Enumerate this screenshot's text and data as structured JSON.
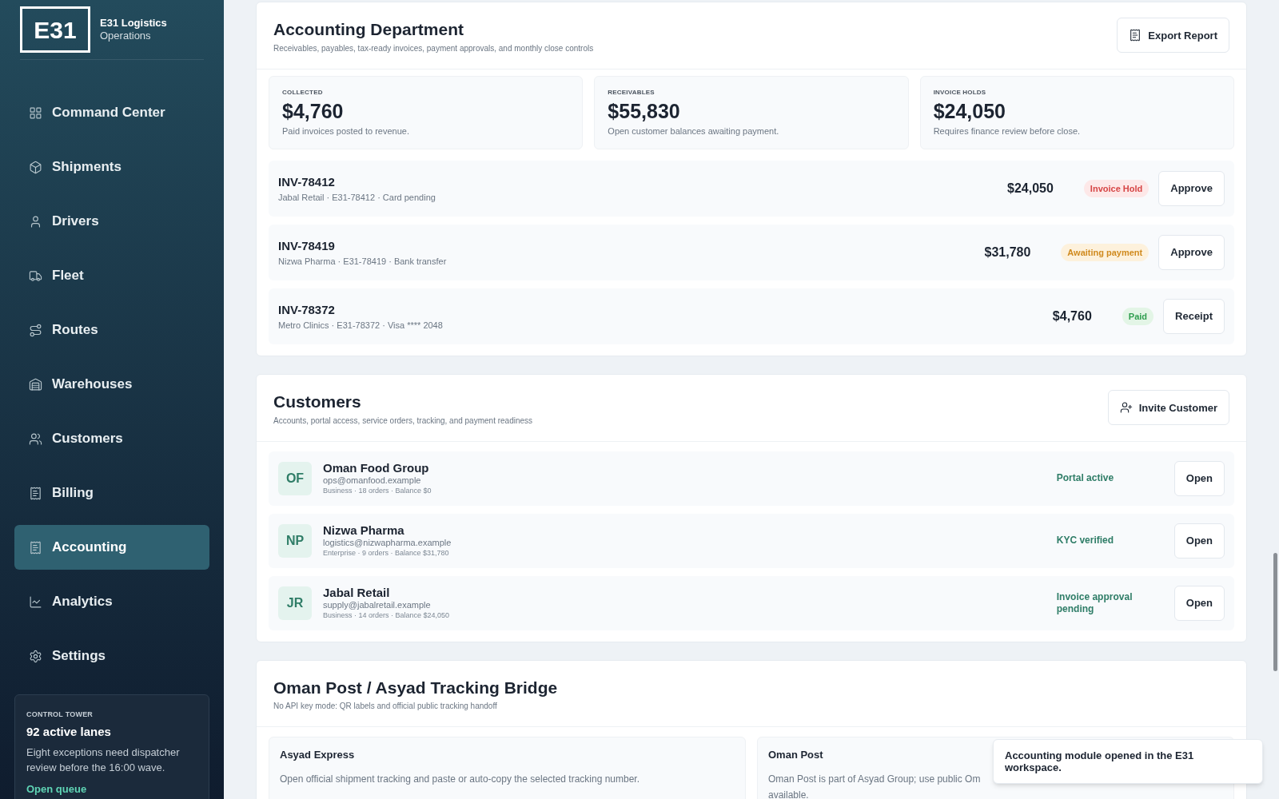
{
  "brand": {
    "logo": "E31",
    "name": "E31 Logistics",
    "subtitle": "Operations"
  },
  "nav": [
    {
      "label": "Command Center",
      "selected": false
    },
    {
      "label": "Shipments",
      "selected": false
    },
    {
      "label": "Drivers",
      "selected": false
    },
    {
      "label": "Fleet",
      "selected": false
    },
    {
      "label": "Routes",
      "selected": false
    },
    {
      "label": "Warehouses",
      "selected": false
    },
    {
      "label": "Customers",
      "selected": false
    },
    {
      "label": "Billing",
      "selected": false
    },
    {
      "label": "Accounting",
      "selected": true
    },
    {
      "label": "Analytics",
      "selected": false
    },
    {
      "label": "Settings",
      "selected": false
    }
  ],
  "control_tower": {
    "eyebrow": "CONTROL TOWER",
    "title": "92 active lanes",
    "text": "Eight exceptions need dispatcher review before the 16:00 wave.",
    "link": "Open queue"
  },
  "accounting": {
    "title": "Accounting Department",
    "subtitle": "Receivables, payables, tax-ready invoices, payment approvals, and monthly close controls",
    "action": "Export Report",
    "stats": [
      {
        "label": "COLLECTED",
        "value": "$4,760",
        "note": "Paid invoices posted to revenue."
      },
      {
        "label": "RECEIVABLES",
        "value": "$55,830",
        "note": "Open customer balances awaiting payment."
      },
      {
        "label": "INVOICE HOLDS",
        "value": "$24,050",
        "note": "Requires finance review before close."
      }
    ],
    "invoices": [
      {
        "id": "INV-78412",
        "detail": "Jabal Retail · E31-78412 · Card pending",
        "amount": "$24,050",
        "status": "Invoice Hold",
        "kind": "hold",
        "action": "Approve"
      },
      {
        "id": "INV-78419",
        "detail": "Nizwa Pharma · E31-78419 · Bank transfer",
        "amount": "$31,780",
        "status": "Awaiting payment",
        "kind": "awaiting",
        "action": "Approve"
      },
      {
        "id": "INV-78372",
        "detail": "Metro Clinics · E31-78372 · Visa **** 2048",
        "amount": "$4,760",
        "status": "Paid",
        "kind": "paid",
        "action": "Receipt"
      }
    ]
  },
  "customers": {
    "title": "Customers",
    "subtitle": "Accounts, portal access, service orders, tracking, and payment readiness",
    "action": "Invite Customer",
    "rows": [
      {
        "initials": "OF",
        "name": "Oman Food Group",
        "email": "ops@omanfood.example",
        "meta": "Business · 18 orders · Balance $0",
        "status": "Portal active",
        "action": "Open"
      },
      {
        "initials": "NP",
        "name": "Nizwa Pharma",
        "email": "logistics@nizwapharma.example",
        "meta": "Enterprise · 9 orders · Balance $31,780",
        "status": "KYC verified",
        "action": "Open"
      },
      {
        "initials": "JR",
        "name": "Jabal Retail",
        "email": "supply@jabalretail.example",
        "meta": "Business · 14 orders · Balance $24,050",
        "status": "Invoice approval pending",
        "action": "Open"
      }
    ]
  },
  "tracking": {
    "title": "Oman Post / Asyad Tracking Bridge",
    "subtitle": "No API key mode: QR labels and official public tracking handoff",
    "carriers": [
      {
        "name": "Asyad Express",
        "text": [
          "Open official shipment tracking and paste or auto-copy the selected tracking number."
        ]
      },
      {
        "name": "Oman Post",
        "text": [
          "Oman Post is part of Asyad Group; use public Om",
          "available."
        ]
      }
    ]
  },
  "toast": "Accounting module opened in the E31 workspace."
}
